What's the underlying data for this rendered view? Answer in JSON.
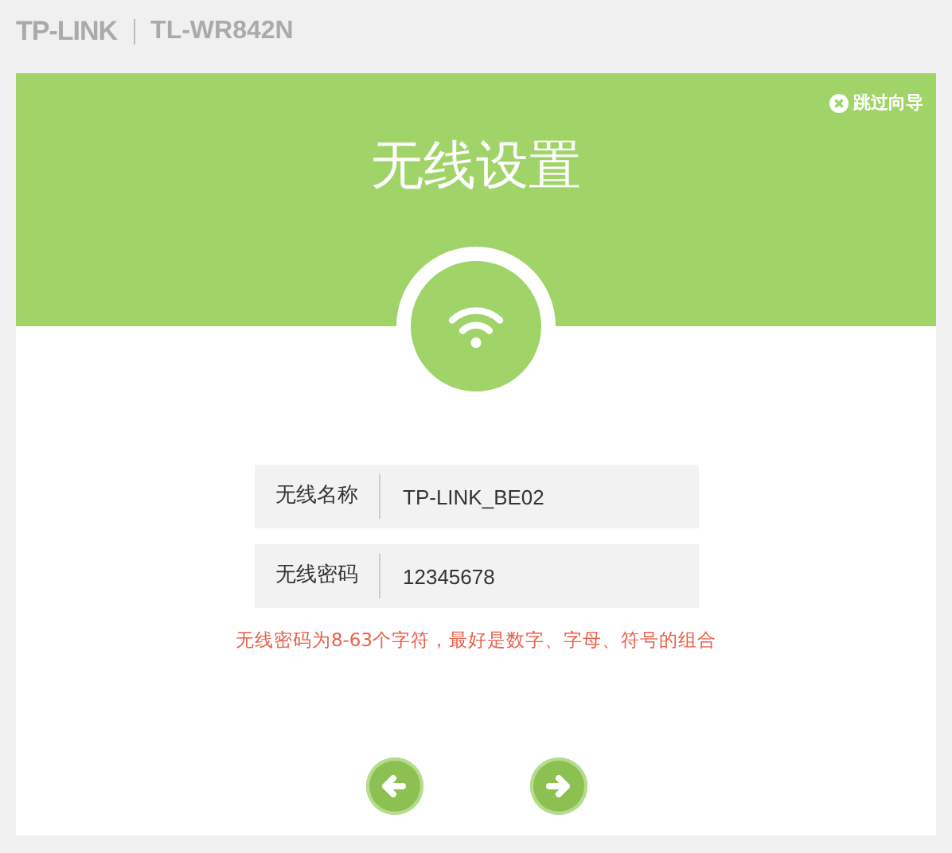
{
  "brand": {
    "logo": "TP-LINK",
    "model": "TL-WR842N"
  },
  "skip_link": {
    "label": "跳过向导"
  },
  "title": "无线设置",
  "fields": [
    {
      "label": "无线名称",
      "value": "TP-LINK_BE02"
    },
    {
      "label": "无线密码",
      "value": "12345678"
    }
  ],
  "hint": "无线密码为8-63个字符，最好是数字、字母、符号的组合",
  "nav_buttons": [
    {
      "kind": "back"
    },
    {
      "kind": "next"
    }
  ]
}
